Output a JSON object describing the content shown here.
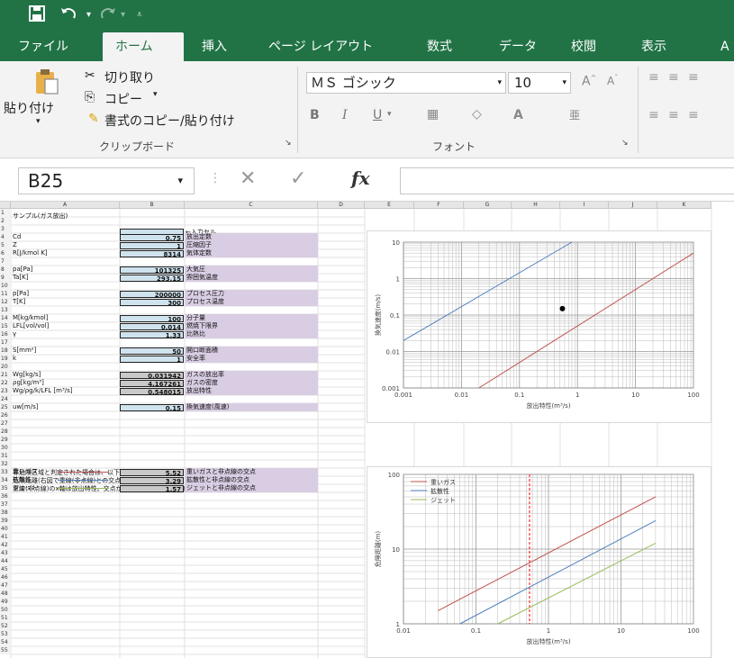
{
  "titlebar": {
    "save_icon": "save-icon",
    "undo_icon": "undo-icon",
    "redo_icon": "redo-icon",
    "customize_icon": "customize-icon"
  },
  "tabs": [
    "ファイル",
    "ホーム",
    "挿入",
    "ページ レイアウト",
    "数式",
    "データ",
    "校閲",
    "表示",
    "A"
  ],
  "ribbon": {
    "paste": "貼り付け",
    "cut": "切り取り",
    "copy": "コピー",
    "format_painter": "書式のコピー/貼り付け",
    "clipboard_group": "クリップボード",
    "font_name": "ＭＳ ゴシック",
    "font_size": "10",
    "bold": "B",
    "italic": "I",
    "underline": "U",
    "font_color": "A",
    "font_group": "フォント"
  },
  "formula_bar": {
    "name_box": "B25",
    "fx": "fx",
    "cancel": "✕",
    "enter": "✓",
    "formula": ""
  },
  "columns": [
    "A",
    "B",
    "C",
    "D",
    "E",
    "F",
    "G",
    "H",
    "I",
    "J",
    "K"
  ],
  "rows": {
    "r1": "サンプル(ガス放出)",
    "r3b": "←入力セル",
    "r4": {
      "a": "Cd",
      "b": "0.75",
      "c": "放出定数"
    },
    "r5": {
      "a": "Z",
      "b": "1",
      "c": "圧縮因子"
    },
    "r6": {
      "a": "R[J/kmol K]",
      "b": "8314",
      "c": "気体定数"
    },
    "r8": {
      "a": "pa[Pa]",
      "b": "101325",
      "c": "大気圧"
    },
    "r9": {
      "a": "Ta[K]",
      "b": "293.15",
      "c": "雰囲気温度"
    },
    "r11": {
      "a": "p[Pa]",
      "b": "200000",
      "c": "プロセス圧力"
    },
    "r12": {
      "a": "T[K]",
      "b": "300",
      "c": "プロセス温度"
    },
    "r14": {
      "a": "M[kg/kmol]",
      "b": "100",
      "c": "分子量"
    },
    "r15": {
      "a": "LFL[vol/vol]",
      "b": "0.014",
      "c": "燃焼下限界"
    },
    "r16": {
      "a": "γ",
      "b": "1.33",
      "c": "比熱比"
    },
    "r18": {
      "a": "S[mm²]",
      "b": "50",
      "c": "開口断面積"
    },
    "r19": {
      "a": "k",
      "b": "1",
      "c": "安全率"
    },
    "r21": {
      "a": "Wg[kg/s]",
      "b": "0.031942",
      "c": "ガスの放出率"
    },
    "r22": {
      "a": "ρg[kg/m³]",
      "b": "4.167261",
      "c": "ガスの密度"
    },
    "r23": {
      "a": "Wg/ρg/k/LFL [m³/s]",
      "b": "0.548015",
      "c": "放出特性"
    },
    "r25": {
      "a": "uw[m/s]",
      "b": "0.15",
      "c": "換気速度(風速)"
    },
    "r29": "非危険区域と判定された場合は、以下を使用しない。",
    "r30": "危険距離(右図で重線(非点線)との交点で評価する)",
    "r31": "重線(非点線)のx軸は放出特性。交点がない場合は、以下の値は使用できない。",
    "r33": {
      "a": "重いガス",
      "b": "5.52",
      "c": "重いガスと非点線の交点"
    },
    "r34": {
      "a": "拡散性",
      "b": "3.29",
      "c": "拡散性と非点線の交点"
    },
    "r35": {
      "a": "ジェット",
      "b": "1.57",
      "c": "ジェットと非点線の交点"
    }
  },
  "chart_data": [
    {
      "type": "line",
      "xlabel": "放出特性(m³/s)",
      "ylabel": "換気速度(m/s)",
      "x_ticks": [
        "0.001",
        "0.01",
        "0.1",
        "1",
        "10",
        "100"
      ],
      "y_ticks": [
        "0.001",
        "0.01",
        "0.1",
        "1",
        "10"
      ],
      "xlim": [
        0.001,
        100
      ],
      "ylim": [
        0.001,
        10
      ],
      "x_scale": "log",
      "y_scale": "log",
      "grid": true,
      "series": [
        {
          "color": "#4f81bd",
          "x": [
            0.001,
            0.8
          ],
          "y": [
            0.02,
            10
          ]
        },
        {
          "color": "#c0504d",
          "x": [
            0.02,
            100
          ],
          "y": [
            0.001,
            5
          ]
        }
      ],
      "point": {
        "x": 0.55,
        "y": 0.15,
        "color": "#000000"
      }
    },
    {
      "type": "line",
      "xlabel": "放出特性(m³/s)",
      "ylabel": "危険距離(m)",
      "x_ticks": [
        "0.01",
        "0.1",
        "1",
        "10",
        "100"
      ],
      "y_ticks": [
        "1",
        "10",
        "100"
      ],
      "xlim": [
        0.01,
        100
      ],
      "ylim": [
        1,
        100
      ],
      "x_scale": "log",
      "y_scale": "log",
      "grid": true,
      "legend": "top-left",
      "series": [
        {
          "name": "重いガス",
          "color": "#c0504d",
          "x": [
            0.03,
            30
          ],
          "y": [
            1.5,
            50
          ]
        },
        {
          "name": "拡散性",
          "color": "#4f81bd",
          "x": [
            0.06,
            30
          ],
          "y": [
            1,
            24
          ]
        },
        {
          "name": "ジェット",
          "color": "#9bbb59",
          "x": [
            0.2,
            30
          ],
          "y": [
            1,
            12
          ]
        }
      ],
      "vline": {
        "x": 0.548015,
        "color": "#ff0000"
      }
    }
  ]
}
